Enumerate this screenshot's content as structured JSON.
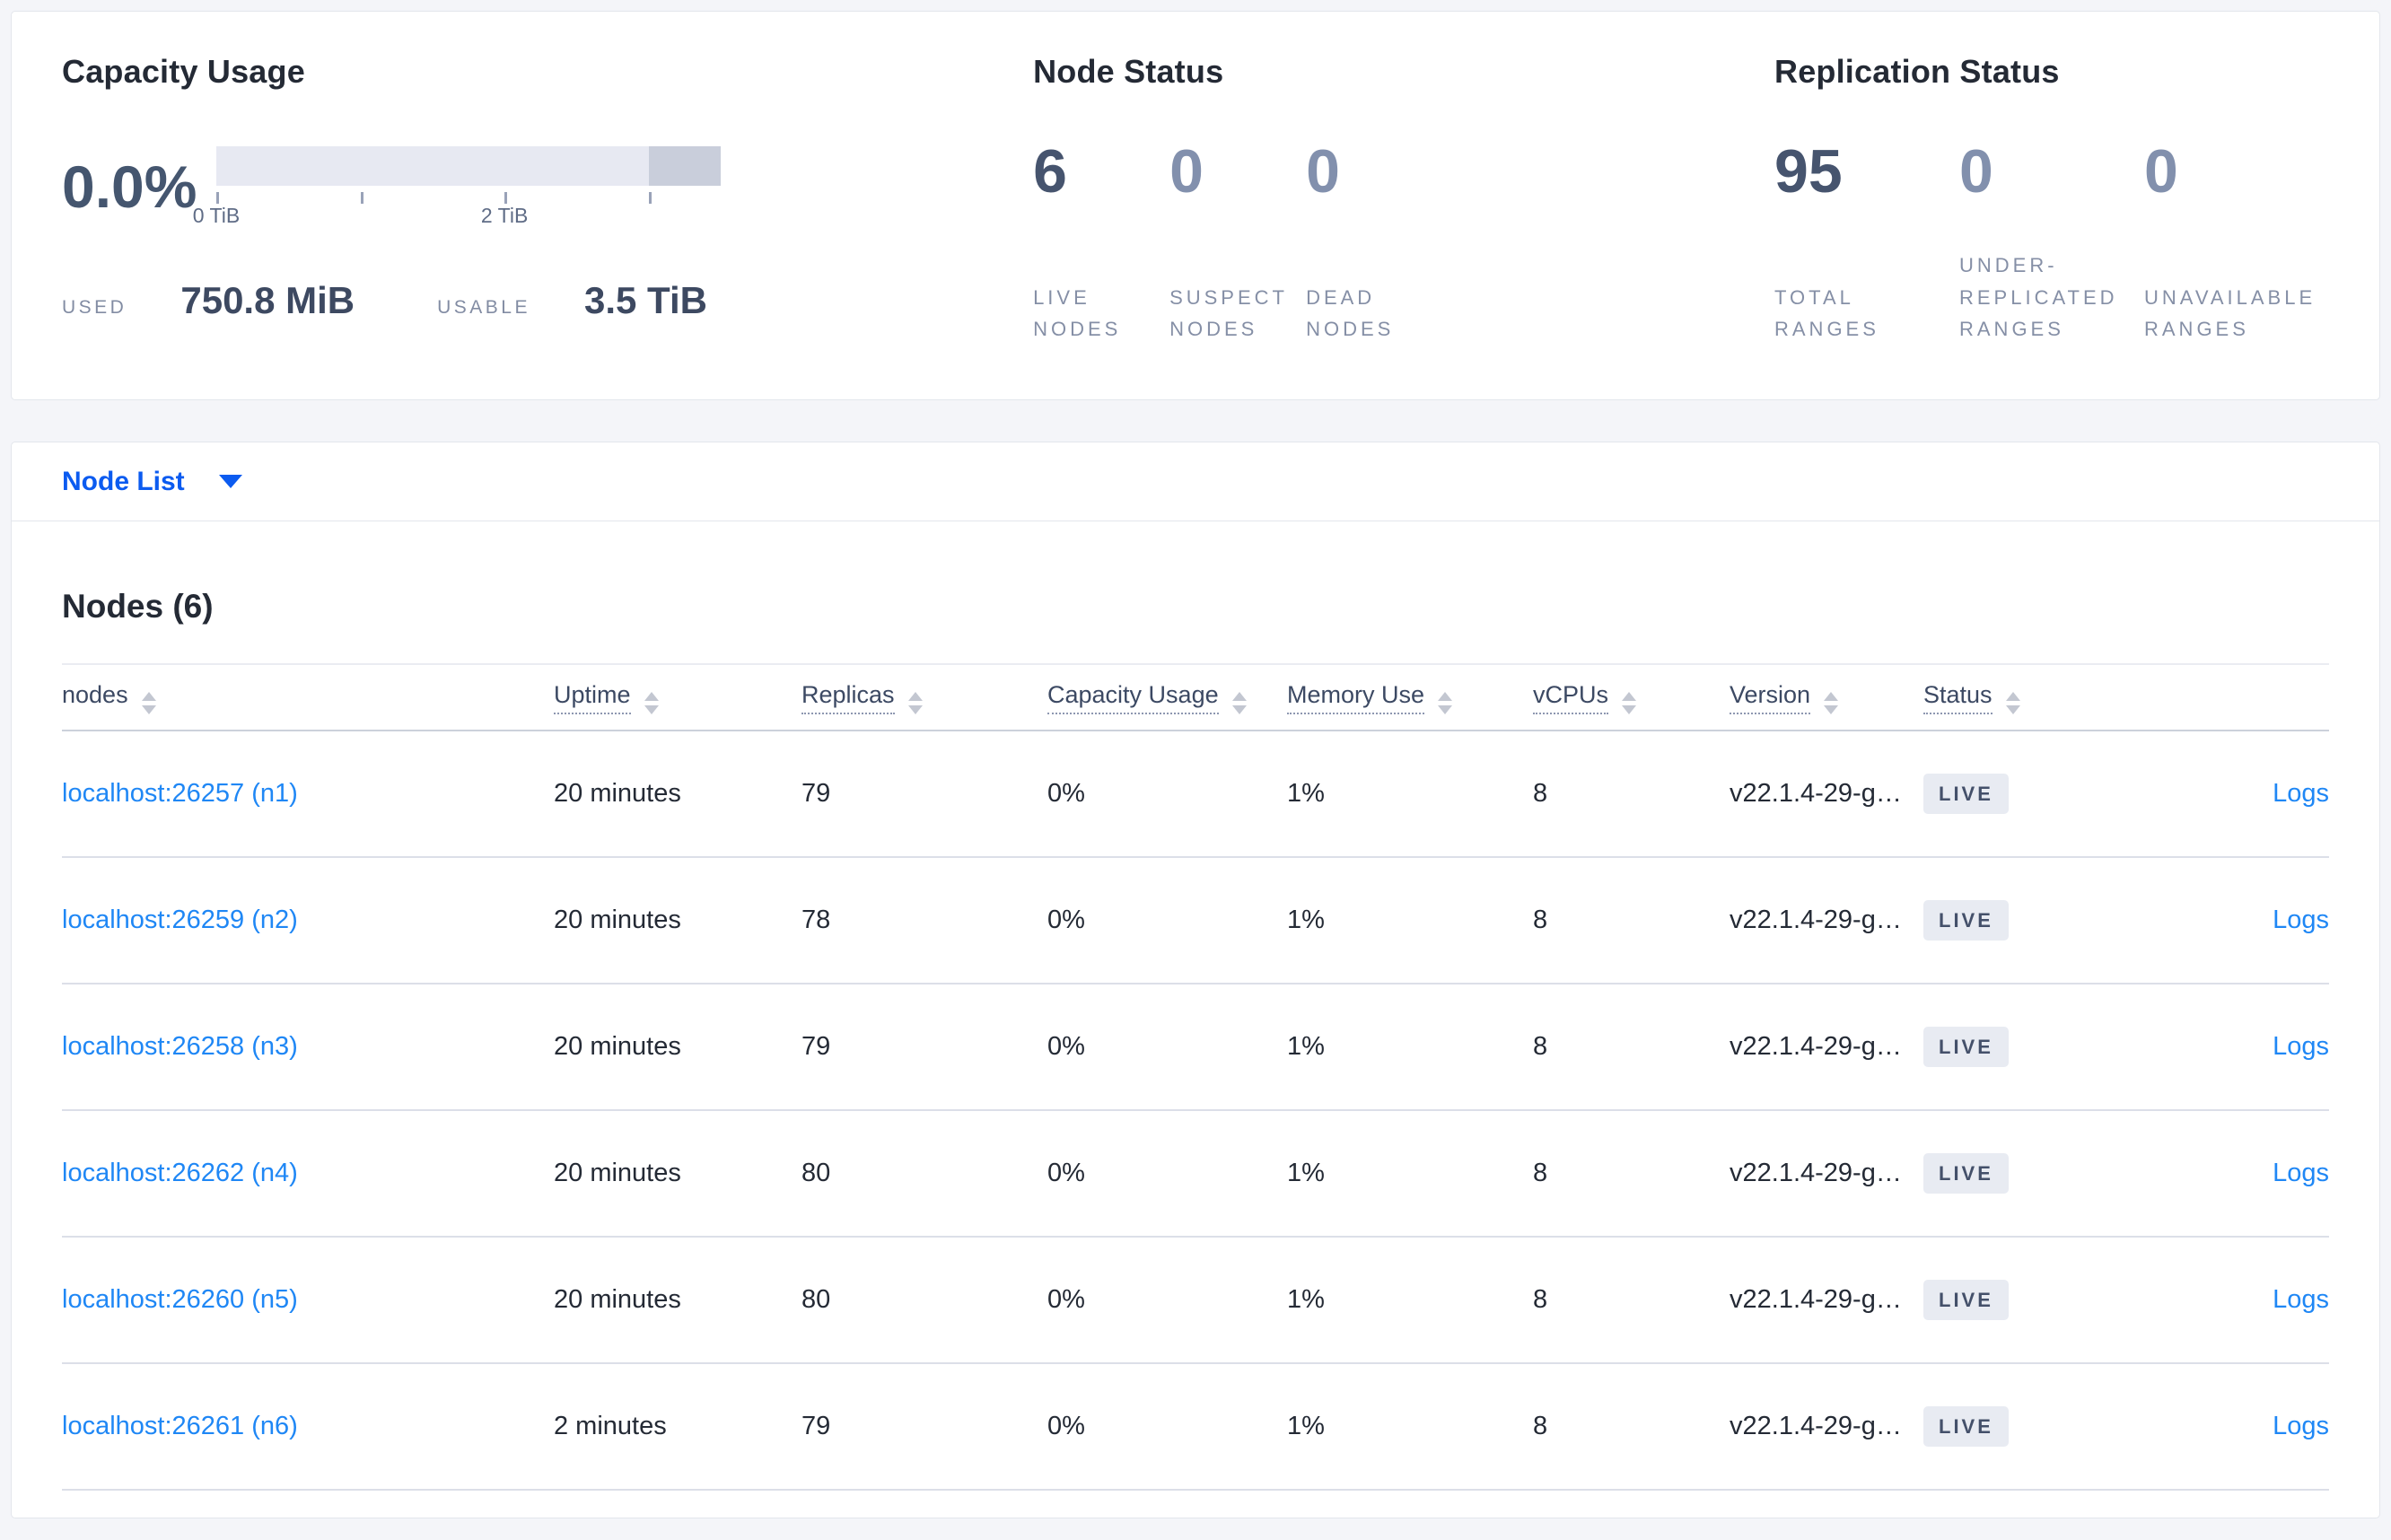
{
  "overview": {
    "capacity": {
      "title": "Capacity Usage",
      "percent": "0.0%",
      "tick_label_0": "0 TiB",
      "tick_label_2": "2 TiB",
      "used_label": "USED",
      "used_value": "750.8 MiB",
      "usable_label": "USABLE",
      "usable_value": "3.5 TiB"
    },
    "node_status": {
      "title": "Node Status",
      "stats": [
        {
          "value": "6",
          "label": "LIVE\nNODES"
        },
        {
          "value": "0",
          "label": "SUSPECT\nNODES"
        },
        {
          "value": "0",
          "label": "DEAD\nNODES"
        }
      ]
    },
    "replication_status": {
      "title": "Replication Status",
      "stats": [
        {
          "value": "95",
          "label": "TOTAL\nRANGES"
        },
        {
          "value": "0",
          "label": "UNDER-\nREPLICATED\nRANGES"
        },
        {
          "value": "0",
          "label": "UNAVAILABLE\nRANGES"
        }
      ]
    }
  },
  "view_selector": {
    "label": "Node List"
  },
  "nodes": {
    "section_title": "Nodes (6)",
    "columns": {
      "nodes": "nodes",
      "uptime": "Uptime",
      "replicas": "Replicas",
      "capacity": "Capacity Usage",
      "memory": "Memory Use",
      "vcpus": "vCPUs",
      "version": "Version",
      "status": "Status"
    },
    "rows": [
      {
        "node": "localhost:26257 (n1)",
        "uptime": "20 minutes",
        "replicas": "79",
        "capacity": "0%",
        "memory": "1%",
        "vcpus": "8",
        "version": "v22.1.4-29-g…",
        "status": "LIVE",
        "logs": "Logs"
      },
      {
        "node": "localhost:26259 (n2)",
        "uptime": "20 minutes",
        "replicas": "78",
        "capacity": "0%",
        "memory": "1%",
        "vcpus": "8",
        "version": "v22.1.4-29-g…",
        "status": "LIVE",
        "logs": "Logs"
      },
      {
        "node": "localhost:26258 (n3)",
        "uptime": "20 minutes",
        "replicas": "79",
        "capacity": "0%",
        "memory": "1%",
        "vcpus": "8",
        "version": "v22.1.4-29-g…",
        "status": "LIVE",
        "logs": "Logs"
      },
      {
        "node": "localhost:26262 (n4)",
        "uptime": "20 minutes",
        "replicas": "80",
        "capacity": "0%",
        "memory": "1%",
        "vcpus": "8",
        "version": "v22.1.4-29-g…",
        "status": "LIVE",
        "logs": "Logs"
      },
      {
        "node": "localhost:26260 (n5)",
        "uptime": "20 minutes",
        "replicas": "80",
        "capacity": "0%",
        "memory": "1%",
        "vcpus": "8",
        "version": "v22.1.4-29-g…",
        "status": "LIVE",
        "logs": "Logs"
      },
      {
        "node": "localhost:26261 (n6)",
        "uptime": "2 minutes",
        "replicas": "79",
        "capacity": "0%",
        "memory": "1%",
        "vcpus": "8",
        "version": "v22.1.4-29-g…",
        "status": "LIVE",
        "logs": "Logs"
      }
    ]
  },
  "colors": {
    "accent_blue": "#0b5bf0",
    "link_blue": "#1f87f5",
    "bar_light": "#e7e9f2",
    "bar_dark": "#c9cedb",
    "badge_bg": "#e8ebf2"
  }
}
